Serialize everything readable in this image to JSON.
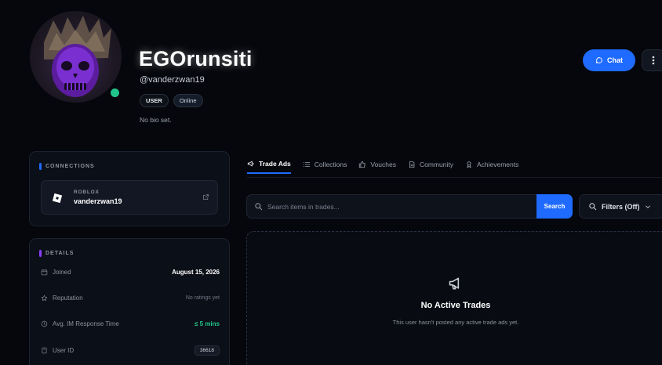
{
  "profile": {
    "username": "EGOrunsiti",
    "handle": "@vanderzwan19",
    "role_badge": "USER",
    "status_badge": "Online",
    "bio": "No bio set.",
    "online_color": "#22c58b"
  },
  "actions": {
    "chat_label": "Chat",
    "chat_icon": "message-bubble-icon",
    "more_icon": "vertical-dots-icon"
  },
  "connections": {
    "title": "CONNECTIONS",
    "accent": "#1f6bff",
    "items": [
      {
        "platform": "ROBLOX",
        "username": "vanderzwan19",
        "icon": "roblox-icon"
      }
    ]
  },
  "details": {
    "title": "DETAILS",
    "accent": "#8b3dff",
    "rows": [
      {
        "label": "Joined",
        "value": "August 15, 2026",
        "icon": "calendar-icon"
      },
      {
        "label": "Reputation",
        "value": "No ratings yet",
        "icon": "star-icon"
      },
      {
        "label": "Avg. IM Response Time",
        "value": "≤ 5 mins",
        "icon": "clock-icon"
      },
      {
        "label": "User ID",
        "value": "36618",
        "icon": "id-card-icon"
      }
    ]
  },
  "tabs": [
    {
      "label": "Trade Ads",
      "icon": "megaphone-icon",
      "active": true
    },
    {
      "label": "Collections",
      "icon": "list-icon",
      "active": false
    },
    {
      "label": "Vouches",
      "icon": "thumbs-up-icon",
      "active": false
    },
    {
      "label": "Community",
      "icon": "document-icon",
      "active": false
    },
    {
      "label": "Achievements",
      "icon": "award-icon",
      "active": false
    }
  ],
  "search": {
    "placeholder": "Search items in trades...",
    "button_label": "Search",
    "filters_label": "Filters (Off)"
  },
  "empty_state": {
    "title": "No Active Trades",
    "subtitle": "This user hasn't posted any active trade ads yet."
  },
  "colors": {
    "accent": "#1f6bff",
    "background": "#05070c",
    "success": "#22c58b"
  }
}
